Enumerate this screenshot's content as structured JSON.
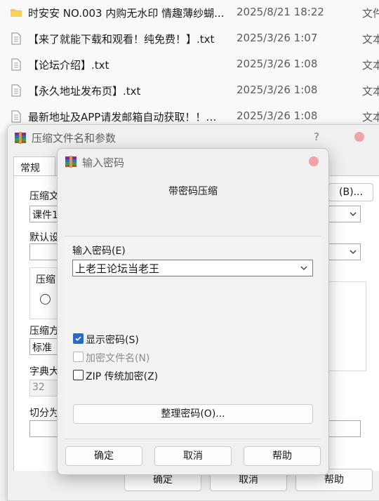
{
  "explorer": {
    "files": [
      {
        "icon": "folder-icon",
        "name": "时安安 NO.003 内购无水印 情趣薄纱蝴...",
        "date": "2025/8/21 18:22",
        "type": "文件"
      },
      {
        "icon": "text-file-icon",
        "name": "【来了就能下载和观看！纯免费！】.txt",
        "date": "2025/3/26 1:07",
        "type": "文本"
      },
      {
        "icon": "text-file-icon",
        "name": "【论坛介绍】.txt",
        "date": "2025/3/26 1:08",
        "type": "文本"
      },
      {
        "icon": "text-file-icon",
        "name": "【永久地址发布页】.txt",
        "date": "2025/3/26 1:08",
        "type": "文本"
      },
      {
        "icon": "text-file-icon",
        "name": "最新地址及APP请发邮箱自动获取！！！...",
        "date": "2025/3/26 1:08",
        "type": "文本"
      }
    ]
  },
  "archive_dialog": {
    "title": "压缩文件名和参数",
    "help_mark": "?",
    "tab_general": "常规",
    "label_archive_name": "压缩文",
    "archive_name_value": "课件1",
    "browse_button": "(B)...",
    "label_default": "默认设",
    "label_format": "压缩",
    "label_method": "压缩方",
    "method_value": "标准",
    "label_dict": "字典大",
    "dict_value": "32",
    "label_split": "切分为",
    "ok_button": "确定",
    "cancel_button": "取消",
    "help_button": "帮助"
  },
  "password_dialog": {
    "title": "输入密码",
    "heading": "带密码压缩",
    "password_label": "输入密码(E)",
    "password_value": "上老王论坛当老王",
    "show_password": {
      "label": "显示密码(S)",
      "checked": true
    },
    "encrypt_names": {
      "label": "加密文件名(N)",
      "checked": false,
      "disabled": true
    },
    "zip_legacy": {
      "label": "ZIP 传统加密(Z)",
      "checked": false
    },
    "manage_button": "整理密码(O)...",
    "ok_button": "确定",
    "cancel_button": "取消",
    "help_button": "帮助"
  },
  "colors": {
    "accent": "#2a6ac4",
    "close_dot": "#f0a3a6",
    "dialog_bg": "#f0f0f0"
  }
}
